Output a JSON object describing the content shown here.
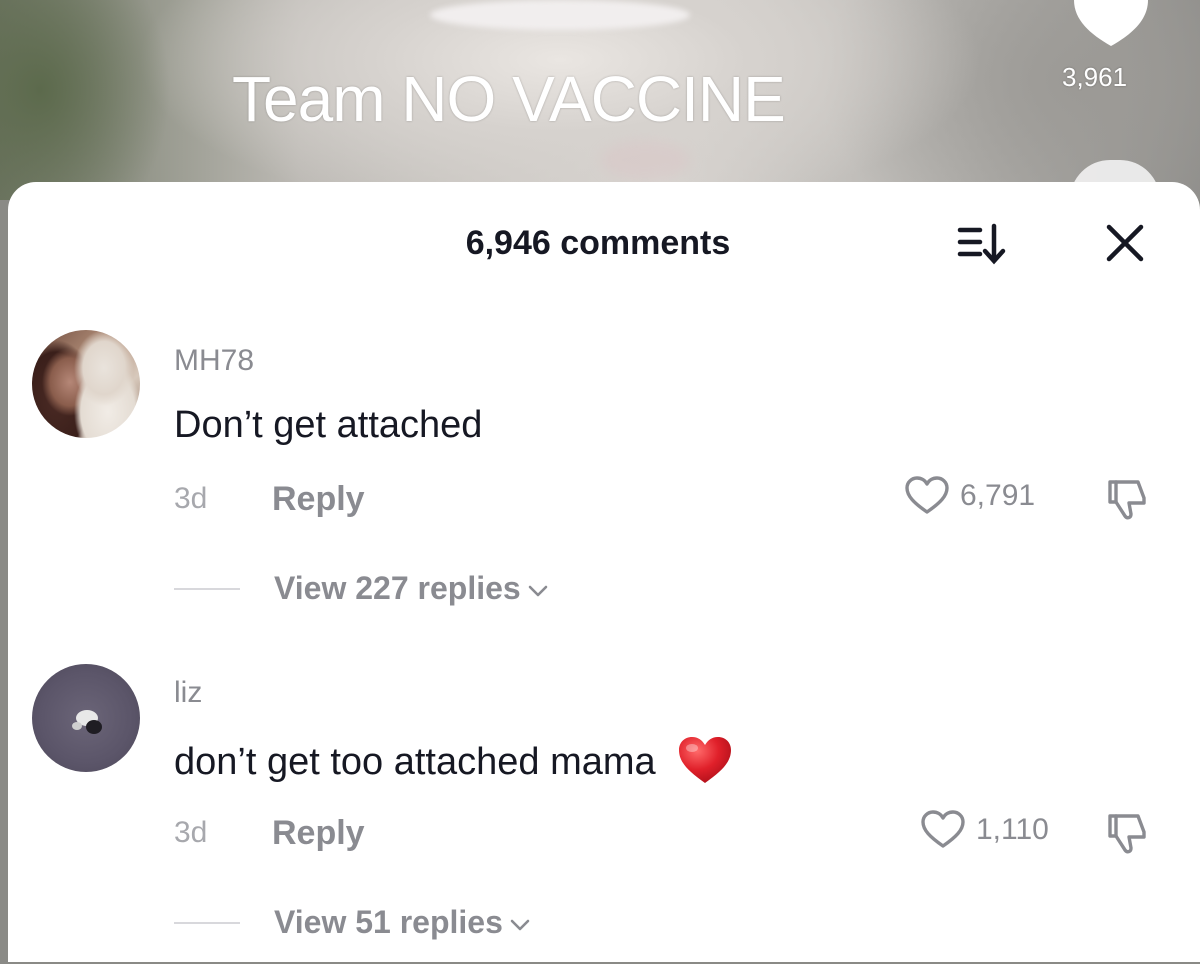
{
  "video": {
    "overlay_text": "Team NO VACCINE",
    "like_count": "3,961"
  },
  "comments_panel": {
    "count_label": "6,946 comments",
    "sort_icon": "sort-icon",
    "close_icon": "close-icon"
  },
  "comments": [
    {
      "username": "MH78",
      "text": "Don’t get attached",
      "time": "3d",
      "reply_label": "Reply",
      "likes": "6,791",
      "view_replies": "View 227 replies"
    },
    {
      "username": "liz",
      "text": "don’t get too attached mama",
      "emoji": "red-heart",
      "time": "3d",
      "reply_label": "Reply",
      "likes": "1,110",
      "view_replies": "View 51 replies"
    }
  ],
  "colors": {
    "primary_text": "#161823",
    "secondary_text": "#8a8b91",
    "heart_emoji": "#e0202a"
  }
}
